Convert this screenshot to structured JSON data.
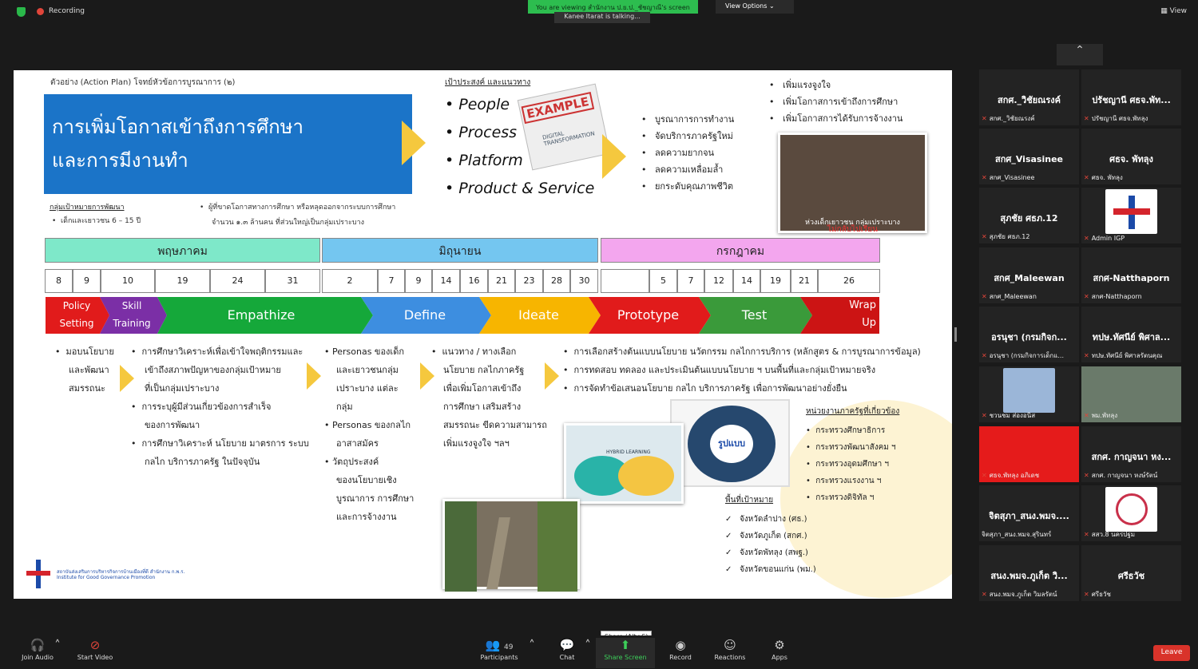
{
  "topbar": {
    "recording": "Recording",
    "viewing_banner": "You are viewing สำนักงาน ป.ย.ป._ชัชญาณี's screen",
    "view_options": "View Options",
    "talking": "Kanee Itarat is talking...",
    "view": "View"
  },
  "slide": {
    "small_heading": "ตัวอย่าง (Action Plan) โจทย์หัวข้อการบูรณาการ (๒)",
    "main_title_line1": "การเพิ่มโอกาสเข้าถึงการศึกษา",
    "main_title_line2": "และการมีงานทำ",
    "goal_title": "เป้าประสงค์ และแนวทาง",
    "pp": [
      "People",
      "Process",
      "Platform",
      "Product & Service"
    ],
    "example_stamp": "EXAMPLE",
    "example_sub": "DIGITAL TRANSFORMATION",
    "integration": [
      "บูรณาการการทำงาน",
      "จัดบริการภาครัฐใหม่",
      "ลดความยากจน",
      "ลดความเหลื่อมล้ำ",
      "ยกระดับคุณภาพชีวิต"
    ],
    "outcomes": [
      "เพิ่มแรงจูงใจ",
      "เพิ่มโอกาสการเข้าถึงการศึกษา",
      "เพิ่มโอกาสการได้รับการจ้างงาน"
    ],
    "photo_caption": "ห่วงเด็กเยาวชน กลุ่มเปราะบาง",
    "photo_caption2": "ไม่กลับไปเรียน",
    "target_title": "กลุ่มเป้าหมายการพัฒนา",
    "target_item": "เด็กและเยาวชน 6 – 15 ปี",
    "target_desc1": "ผู้ที่ขาดโอกาสทางการศึกษา หรือหลุดออกจากระบบการศึกษา",
    "target_desc2": "จำนวน ๑.๓ ล้านคน ที่ส่วนใหญ่เป็นกลุ่มเปราะบาง",
    "months": [
      "พฤษภาคม",
      "มิถุนายน",
      "กรกฎาคม"
    ],
    "days_may": [
      "8",
      "9",
      "10",
      "19",
      "24",
      "31"
    ],
    "days_jun": [
      "2",
      "7",
      "9",
      "14",
      "16",
      "21",
      "23",
      "28",
      "30"
    ],
    "days_jul": [
      "",
      "5",
      "7",
      "12",
      "14",
      "19",
      "21",
      "26"
    ],
    "stages": {
      "policy": "Policy",
      "setting": "Setting",
      "skill": "Skill",
      "training": "Training",
      "empathize": "Empathize",
      "define": "Define",
      "ideate": "Ideate",
      "prototype": "Prototype",
      "test": "Test",
      "wrap": "Wrap",
      "up": "Up"
    },
    "col1": [
      "มอบนโยบาย",
      "และพัฒนา",
      "สมรรถนะ"
    ],
    "col2": [
      "การศึกษาวิเคราะห์เพื่อเข้าใจพฤติกรรมและ",
      "เข้าถึงสภาพปัญหาของกลุ่มเป้าหมาย",
      "ที่เป็นกลุ่มเปราะบาง",
      "การระบุผู้มีส่วนเกี่ยวข้องการสำเร็จ",
      "ของการพัฒนา",
      "การศึกษาวิเคราะห์ นโยบาย มาตรการ ระบบ",
      "กลไก บริการภาครัฐ ในปัจจุบัน"
    ],
    "col3": [
      "Personas ของเด็ก",
      "และเยาวชนกลุ่ม",
      "เปราะบาง แต่ละ",
      "กลุ่ม",
      "Personas ของกลไก",
      "อาสาสมัคร",
      "วัตถุประสงค์",
      "ของนโยบายเชิง",
      "บูรณาการ การศึกษา",
      "และการจ้างงาน"
    ],
    "col4": [
      "แนวทาง / ทางเลือก",
      "นโยบาย กลไกภาครัฐ",
      "เพื่อเพิ่มโอกาสเข้าถึง",
      "การศึกษา เสริมสร้าง",
      "สมรรถนะ ขีดความสามารถ",
      "เพิ่มแรงจูงใจ ฯลฯ"
    ],
    "col5": [
      "การเลือกสร้างต้นแบบนโยบาย นวัตกรรม กลไกการบริการ (หลักสูตร & การบูรณาการข้อมูล)",
      "การทดสอบ ทดลอง และประเมินต้นแบบนโยบาย ฯ บนพื้นที่และกลุ่มเป้าหมายจริง",
      "การจัดทำข้อเสนอนโยบาย กลไก บริการภาครัฐ เพื่อการพัฒนาอย่างยั่งยืน"
    ],
    "model_title": "รูปแบบ",
    "tech_label": "HYBRID LEARNING",
    "agencies_title": "หน่วยงานภาครัฐที่เกี่ยวข้อง",
    "agencies": [
      "กระทรวงศึกษาธิการ",
      "กระทรวงพัฒนาสังคม ฯ",
      "กระทรวงอุดมศึกษา ฯ",
      "กระทรวงแรงงาน ฯ",
      "กระทรวงดิจิทัล ฯ"
    ],
    "area_title": "พื้นที่เป้าหมาย",
    "areas": [
      "จังหวัดลำปาง (ศธ.)",
      "จังหวัดภูเก็ต (สกศ.)",
      "จังหวัดพัทลุง (สพฐ.)",
      "จังหวัดขอนแก่น (พม.)"
    ],
    "logo_th": "สถาบันส่งเสริมการบริหารกิจการบ้านเมืองที่ดี สำนักงาน ก.พ.ร.",
    "logo_en": "Institute for Good Governance Promotion"
  },
  "participants": [
    {
      "name": "สกศ._วิชัยณรงค์",
      "label": "สกศ._วิชัยณรงค์"
    },
    {
      "name": "ปรัชญานี ศธจ.พัท...",
      "label": "ปรัชญานี ศธจ.พัทลุง"
    },
    {
      "name": "สกศ_Visasinee",
      "label": "สกศ_Visasinee"
    },
    {
      "name": "ศธจ. พัทลุง",
      "label": "ศธจ. พัทลุง"
    },
    {
      "name": "สุภชัย ศธภ.12",
      "label": "สุภชัย ศธภ.12"
    },
    {
      "name": "",
      "label": "Admin IGP"
    },
    {
      "name": "สกศ_Maleewan",
      "label": "สกศ_Maleewan"
    },
    {
      "name": "สกศ-Natthaporn",
      "label": "สกศ-Natthaporn"
    },
    {
      "name": "อรนุชา (กรมกิจก...",
      "label": "อรนุชา (กรมกิจการเด็กแ..."
    },
    {
      "name": "ทปษ.ทัศนีย์ พิศาล...",
      "label": "ทปษ.ทัศนีย์ พิศาลรัตนคุณ"
    },
    {
      "name": "",
      "label": "ชวนชม ส่องอนิส"
    },
    {
      "name": "",
      "label": "พม.พัทลุง"
    },
    {
      "name": "",
      "label": "ศธจ.พัทลุง อภิเดช"
    },
    {
      "name": "สกศ. กาญจนา หง...",
      "label": "สกศ. กาญจนา หงษ์รัตน์"
    },
    {
      "name": "จิตสุภา_สนง.พมจ....",
      "label": "จิตสุภา_สนง.พมจ.สุรินทร์"
    },
    {
      "name": "",
      "label": "สสว.8 นครปฐม"
    },
    {
      "name": "สนง.พมจ.ภูเก็ต วิ...",
      "label": "สนง.พมจ.ภูเก็ต วิมลรัตน์"
    },
    {
      "name": "ศรีธวัช",
      "label": "ศรีธวัช"
    }
  ],
  "bottombar": {
    "join_audio": "Join Audio",
    "start_video": "Start Video",
    "participants": "Participants",
    "participant_count": "49",
    "chat": "Chat",
    "share_screen": "Share Screen",
    "share_tooltip": "Share (Alt+S)",
    "record": "Record",
    "reactions": "Reactions",
    "apps": "Apps",
    "leave": "Leave"
  }
}
